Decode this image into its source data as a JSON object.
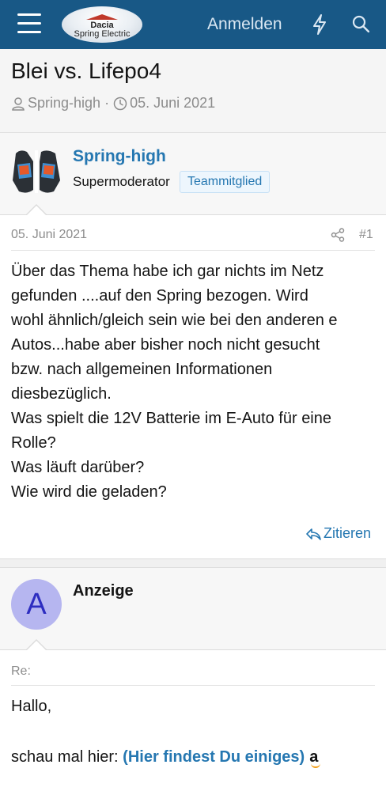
{
  "header": {
    "logo_brand": "Dacia",
    "logo_sub": "Spring Electric",
    "login_label": "Anmelden"
  },
  "thread": {
    "title": "Blei vs. Lifepo4",
    "author": "Spring-high",
    "separator": "·",
    "date": "05. Juni 2021"
  },
  "post": {
    "author_name": "Spring-high",
    "role": "Supermoderator",
    "badge": "Teammitglied",
    "date": "05. Juni 2021",
    "number": "#1",
    "lines": [
      "Über das Thema habe ich gar nichts im Netz",
      "gefunden ....auf den Spring bezogen. Wird",
      "wohl ähnlich/gleich sein wie bei den anderen e",
      "Autos...habe aber bisher noch nicht gesucht",
      "bzw. nach allgemeinen Informationen",
      "diesbezüglich.",
      "Was spielt die 12V Batterie im E-Auto für eine",
      "Rolle?",
      "Was läuft darüber?",
      "Wie wird die geladen?"
    ],
    "quote_label": "Zitieren"
  },
  "ad": {
    "avatar_letter": "A",
    "name": "Anzeige",
    "re_label": "Re:",
    "greeting": "Hallo,",
    "text_prefix": "schau mal hier: ",
    "link_text": "(Hier findest Du einiges)",
    "amazon_glyph": "a"
  },
  "colors": {
    "header_bg": "#185886",
    "link": "#2577b1",
    "muted": "#8c8c8c"
  }
}
